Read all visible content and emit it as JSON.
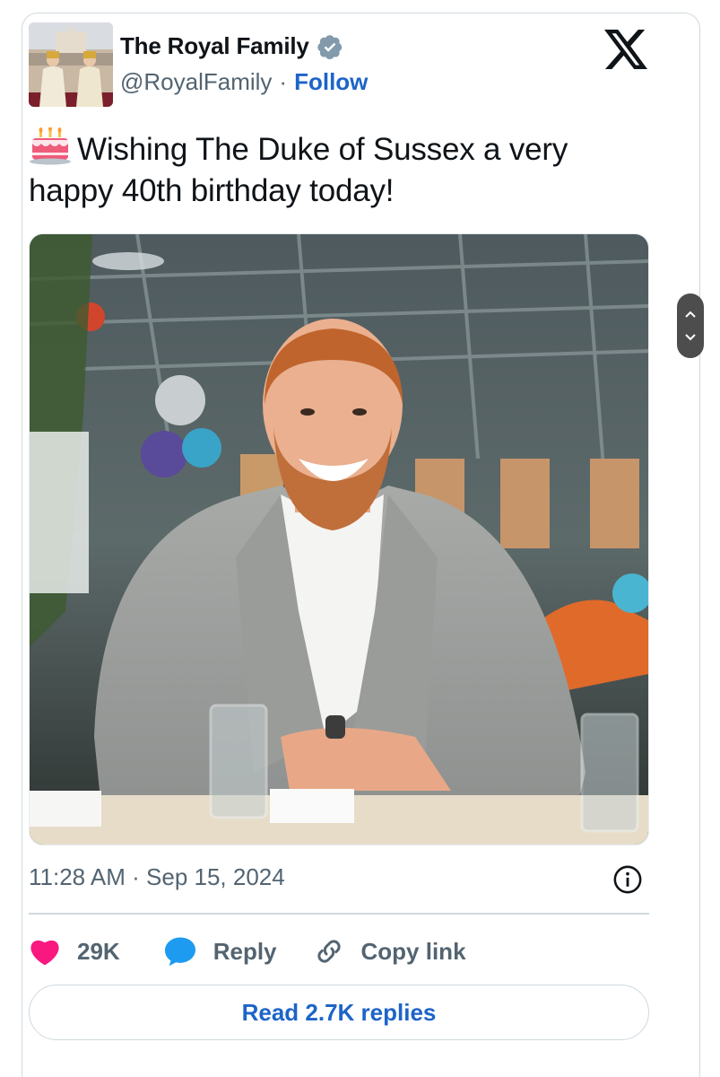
{
  "header": {
    "account_name": "The Royal Family",
    "handle": "@RoyalFamily",
    "separator": "·",
    "follow_label": "Follow",
    "verified_color": "#829aab",
    "logo_icon": "x-logo-icon"
  },
  "tweet": {
    "emoji_icon": "birthday-cake-icon",
    "text": "Wishing The Duke of Sussex a very happy 40th birthday today!"
  },
  "meta": {
    "timestamp": "11:28 AM · Sep 15, 2024"
  },
  "actions": {
    "like_count": "29K",
    "reply_label": "Reply",
    "copy_link_label": "Copy link",
    "like_color": "#f91880",
    "reply_color": "#1d9bf0"
  },
  "read_replies_label": "Read 2.7K replies",
  "accent_color": "#1d64c8"
}
